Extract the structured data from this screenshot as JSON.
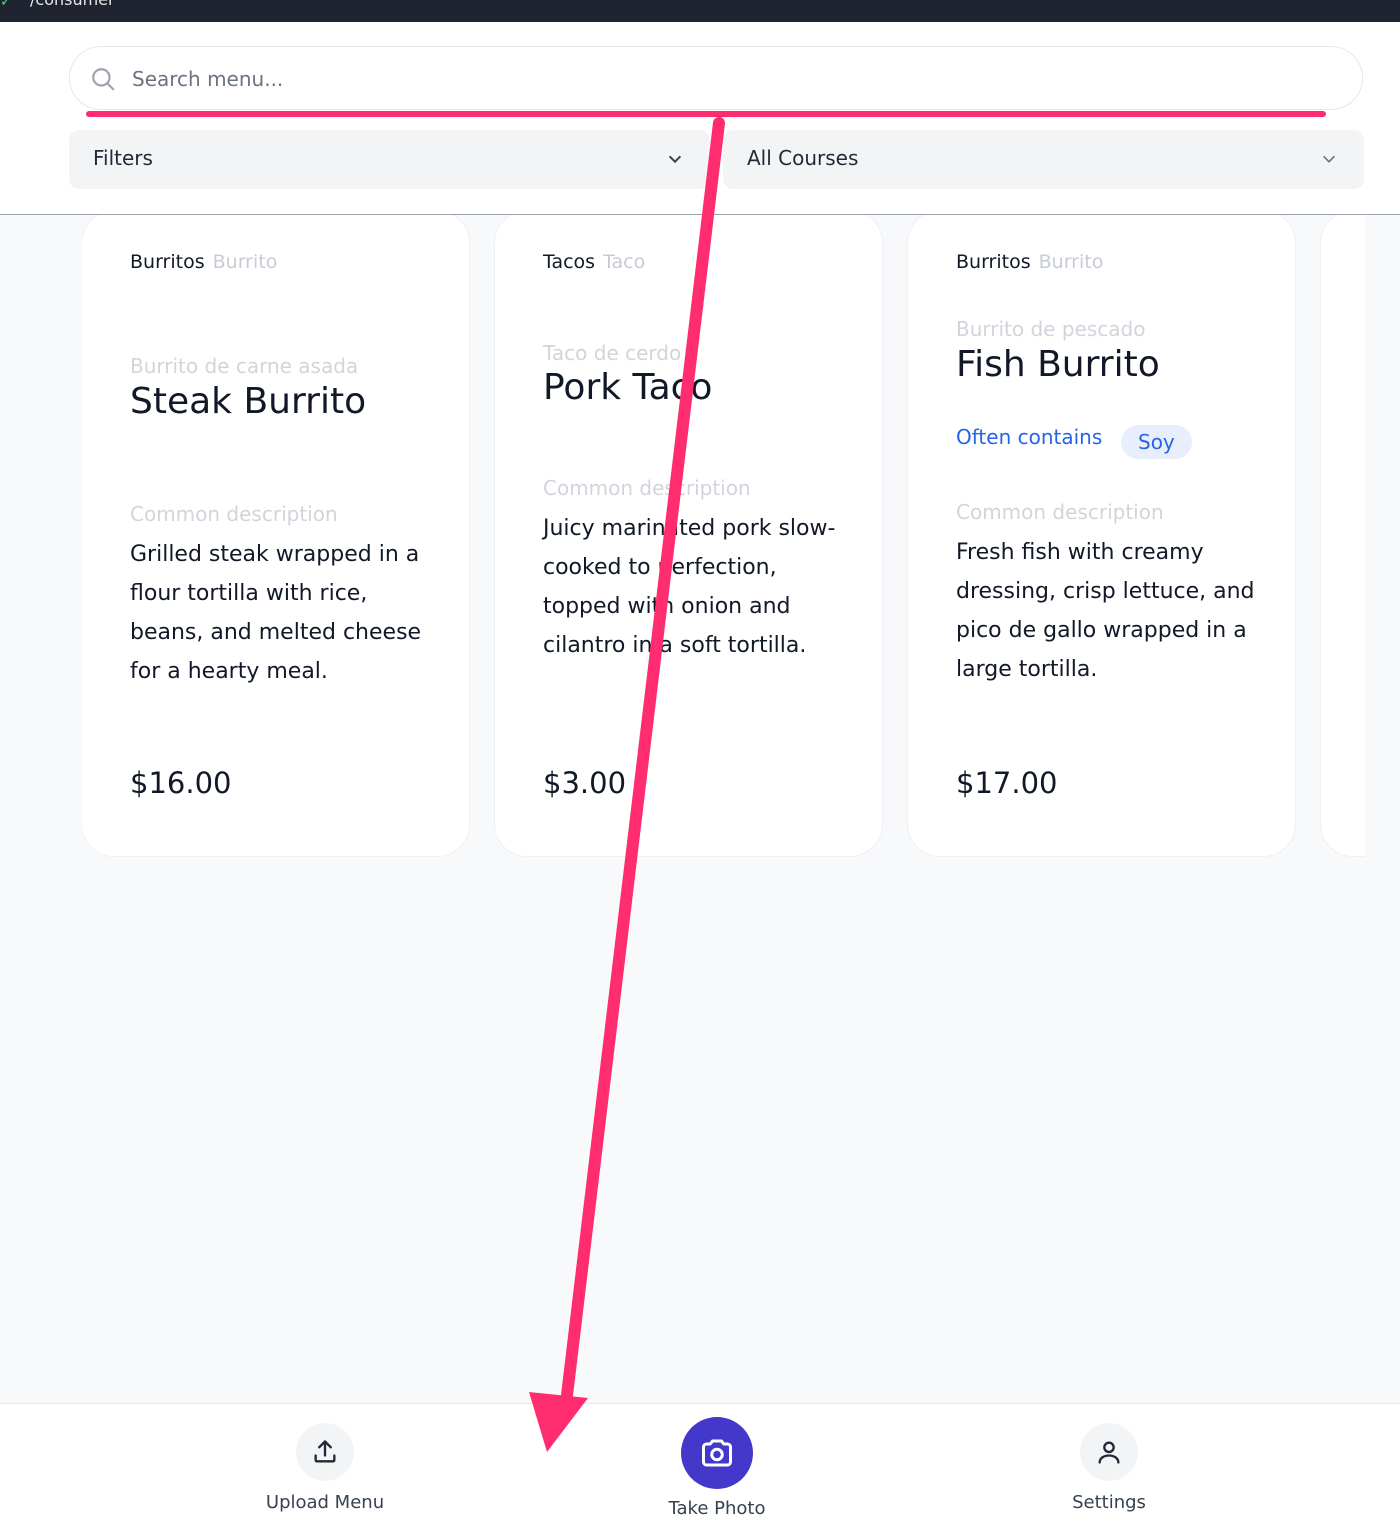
{
  "topbar": {
    "text": "/consumer"
  },
  "search": {
    "placeholder": "Search menu..."
  },
  "filters": {
    "filter_label": "Filters",
    "course_label": "All Courses"
  },
  "cards": [
    {
      "category": "Burritos",
      "category_sub": "Burrito",
      "original_name": "Burrito de carne asada",
      "name": "Steak Burrito",
      "desc_label": "Common description",
      "description": "Grilled steak wrapped in a flour tortilla with rice, beans, and melted cheese for a hearty meal.",
      "price": "$16.00"
    },
    {
      "category": "Tacos",
      "category_sub": "Taco",
      "original_name": "Taco de cerdo",
      "name": "Pork Taco",
      "desc_label": "Common description",
      "description": "Juicy marinated pork slow-cooked to perfection, topped with onion and cilantro in a soft tortilla.",
      "price": "$3.00"
    },
    {
      "category": "Burritos",
      "category_sub": "Burrito",
      "original_name": "Burrito de pescado",
      "name": "Fish Burrito",
      "allergen_label": "Often contains",
      "allergen": "Soy",
      "desc_label": "Common description",
      "description": "Fresh fish with creamy dressing, crisp lettuce, and pico de gallo wrapped in a large tortilla.",
      "price": "$17.00"
    }
  ],
  "bottom_nav": {
    "upload": "Upload Menu",
    "photo": "Take Photo",
    "settings": "Settings"
  },
  "colors": {
    "accent": "#4338ca",
    "annotation": "#ff2d6f",
    "allergen": "#2563eb"
  },
  "icons": [
    "search-icon",
    "chevron-down-icon",
    "upload-icon",
    "camera-icon",
    "user-icon"
  ]
}
